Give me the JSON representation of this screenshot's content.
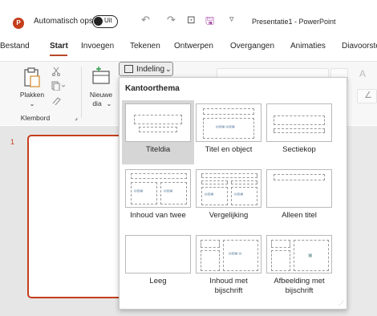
{
  "titlebar": {
    "logo_letter": "P",
    "autosave_label": "Automatisch opslaan",
    "toggle_state": "Uit",
    "undo_icon": "↶",
    "redo_icon": "↷",
    "present_icon": "⊡",
    "save_icon": "🖫",
    "customize_icon": "▿",
    "doc_title": "Presentatie1  -  PowerPoint"
  },
  "tabs": [
    "Bestand",
    "Start",
    "Invoegen",
    "Tekenen",
    "Ontwerpen",
    "Overgangen",
    "Animaties",
    "Diavoorstelling"
  ],
  "active_tab": "Start",
  "ribbon": {
    "paste_label": "Plakken",
    "paste_caret": "⌄",
    "new_slide_label": "Nieuwe",
    "new_slide_label2": "dia",
    "new_slide_caret": "⌄",
    "layout_button": "Indeling",
    "layout_caret": "⌄",
    "clipboard_group": "Klembord",
    "dialog_launcher": "⌟"
  },
  "slides_pane": {
    "slide_number": "1"
  },
  "layout_gallery": {
    "header": "Kantoorthema",
    "items": [
      {
        "caption": "Titeldia",
        "selected": true
      },
      {
        "caption": "Titel en object",
        "selected": false
      },
      {
        "caption": "Sectiekop",
        "selected": false
      },
      {
        "caption": "Inhoud van twee",
        "selected": false
      },
      {
        "caption": "Vergelijking",
        "selected": false
      },
      {
        "caption": "Alleen titel",
        "selected": false
      },
      {
        "caption": "Leeg",
        "selected": false
      },
      {
        "caption": "Inhoud met bijschrift",
        "selected": false
      },
      {
        "caption": "Afbeelding met bijschrift",
        "selected": false
      }
    ],
    "resize_grip": "⋰"
  },
  "colors": {
    "accent": "#c43e1c",
    "selected_bg": "#d6d6d6",
    "ribbon_bg": "#f7f7f7"
  }
}
